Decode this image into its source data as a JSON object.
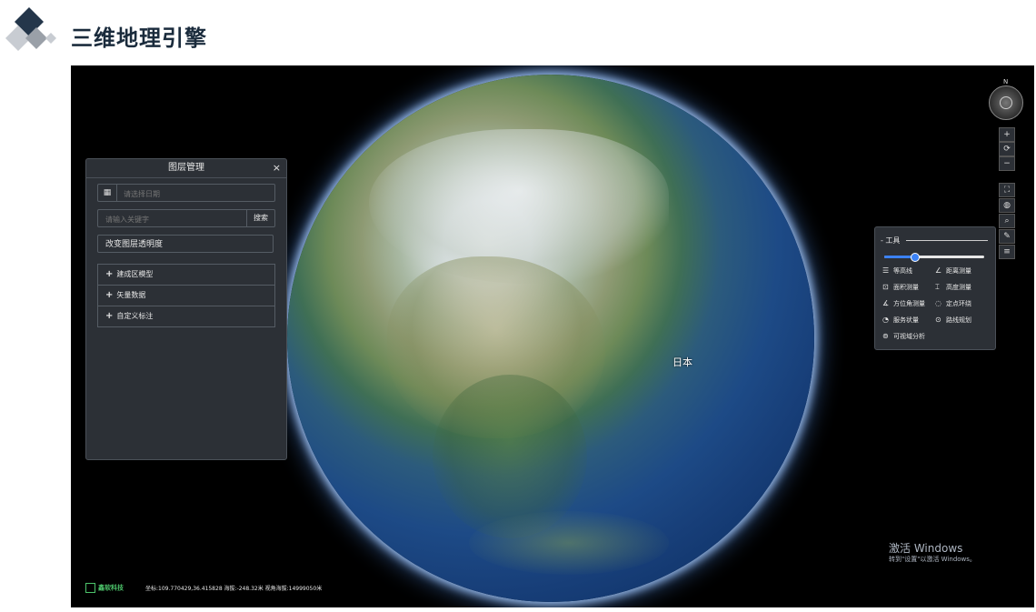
{
  "header": {
    "title": "三维地理引擎"
  },
  "layer_panel": {
    "title": "图层管理",
    "close": "×",
    "date_placeholder": "请选择日期",
    "search_placeholder": "请输入关键字",
    "search_button": "搜索",
    "opacity_button": "改变图层透明度",
    "items": [
      {
        "label": "建成区模型"
      },
      {
        "label": "矢量数据"
      },
      {
        "label": "自定义标注"
      }
    ]
  },
  "globe": {
    "labels": [
      "日本"
    ]
  },
  "tools": {
    "title": "- 工具",
    "slider_value": 0.3,
    "items": [
      {
        "label": "等高线",
        "icon": "contour-icon"
      },
      {
        "label": "距离测量",
        "icon": "ruler-icon"
      },
      {
        "label": "面积测量",
        "icon": "area-icon"
      },
      {
        "label": "高度测量",
        "icon": "height-icon"
      },
      {
        "label": "方位角测量",
        "icon": "angle-icon"
      },
      {
        "label": "定点环绕",
        "icon": "orbit-icon"
      },
      {
        "label": "服务状量",
        "icon": "pie-icon"
      },
      {
        "label": "路线规划",
        "icon": "route-icon"
      },
      {
        "label": "可视域分析",
        "icon": "viewshed-icon"
      }
    ]
  },
  "controls": {
    "compass_north": "N",
    "zoom_in": "+",
    "reset": "⟳",
    "zoom_out": "−"
  },
  "watermark": {
    "line1": "激活 Windows",
    "line2": "转到\"设置\"以激活 Windows。"
  },
  "footer": {
    "company": "鑫软科技",
    "status": "坐标:109.770429,36.415828 海拔:-248.32米 视角海拔:14999050米"
  }
}
